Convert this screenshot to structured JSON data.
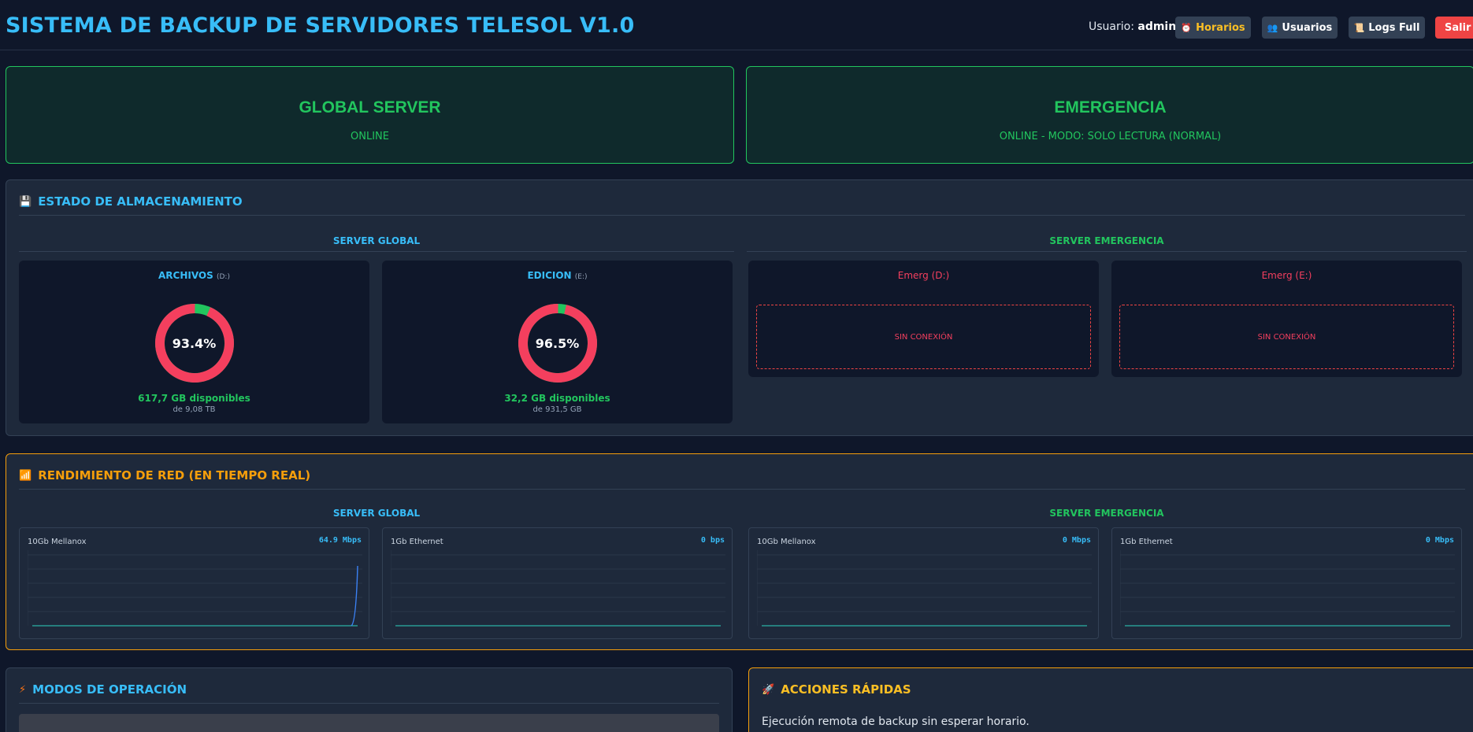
{
  "header": {
    "title": "SISTEMA DE BACKUP DE SERVIDORES TELESOL V1.0",
    "user_prefix": "Usuario:",
    "user_name": "admin",
    "buttons": {
      "horarios": "Horarios",
      "usuarios": "Usuarios",
      "logs": "Logs Full",
      "salir": "Salir"
    },
    "icons": {
      "horarios": "alarm-clock-icon",
      "usuarios": "users-icon",
      "logs": "scroll-icon"
    }
  },
  "status": {
    "global": {
      "name": "GLOBAL SERVER",
      "state": "ONLINE"
    },
    "emerg": {
      "name": "EMERGENCIA",
      "state": "ONLINE - MODO: SOLO LECTURA (NORMAL)"
    }
  },
  "storage": {
    "title": "ESTADO DE ALMACENAMIENTO",
    "icon": "floppy-disk-icon",
    "global_head": "SERVER GLOBAL",
    "emerg_head": "SERVER EMERGENCIA",
    "disks": [
      {
        "name": "ARCHIVOS",
        "drive": "(D:)",
        "percent_label": "93.4%",
        "used_fraction": 0.934,
        "available": "617,7 GB disponibles",
        "total": "de 9,08 TB"
      },
      {
        "name": "EDICION",
        "drive": "(E:)",
        "percent_label": "96.5%",
        "used_fraction": 0.965,
        "available": "32,2 GB disponibles",
        "total": "de 931,5 GB"
      }
    ],
    "emerg_disks": [
      {
        "name": "Emerg (D:)",
        "status": "SIN CONEXIÓN"
      },
      {
        "name": "Emerg (E:)",
        "status": "SIN CONEXIÓN"
      }
    ]
  },
  "network": {
    "title": "RENDIMIENTO DE RED (EN TIEMPO REAL)",
    "icon": "bar-chart-icon",
    "global_head": "SERVER GLOBAL",
    "emerg_head": "SERVER EMERGENCIA",
    "cards": [
      {
        "nic": "10Gb Mellanox",
        "rate": "64.9 Mbps",
        "spike": true
      },
      {
        "nic": "1Gb Ethernet",
        "rate": "0 bps",
        "spike": false
      },
      {
        "nic": "10Gb Mellanox",
        "rate": "0 Mbps",
        "spike": false
      },
      {
        "nic": "1Gb Ethernet",
        "rate": "0 Mbps",
        "spike": false
      }
    ]
  },
  "modos": {
    "title": "MODOS DE OPERACIÓN",
    "icon": "lightning-icon"
  },
  "acciones": {
    "title": "ACCIONES RÁPIDAS",
    "icon": "rocket-icon",
    "text": "Ejecución remota de backup sin esperar horario."
  },
  "colors": {
    "accent": "#38bdf8",
    "online": "#22c55e",
    "used": "#f43f5e",
    "warning": "#f59e0b"
  }
}
